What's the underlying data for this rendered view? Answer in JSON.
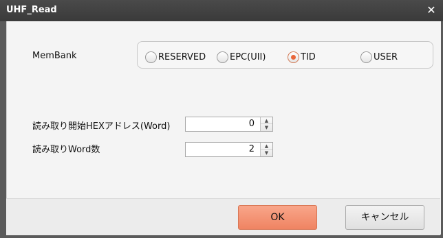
{
  "window": {
    "title": "UHF_Read",
    "close_label": "✕"
  },
  "membank": {
    "label": "MemBank",
    "options": [
      "RESERVED",
      "EPC(UII)",
      "TID",
      "USER"
    ],
    "selected": "TID"
  },
  "start_address": {
    "label": "読み取り開始HEXアドレス(Word)",
    "value": "0"
  },
  "word_count": {
    "label": "読み取りWord数",
    "value": "2"
  },
  "buttons": {
    "ok": "OK",
    "cancel": "キャンセル"
  },
  "colors": {
    "accent": "#ef8462",
    "selected_dot": "#e9663a",
    "titlebar": "#3a3a3a"
  }
}
